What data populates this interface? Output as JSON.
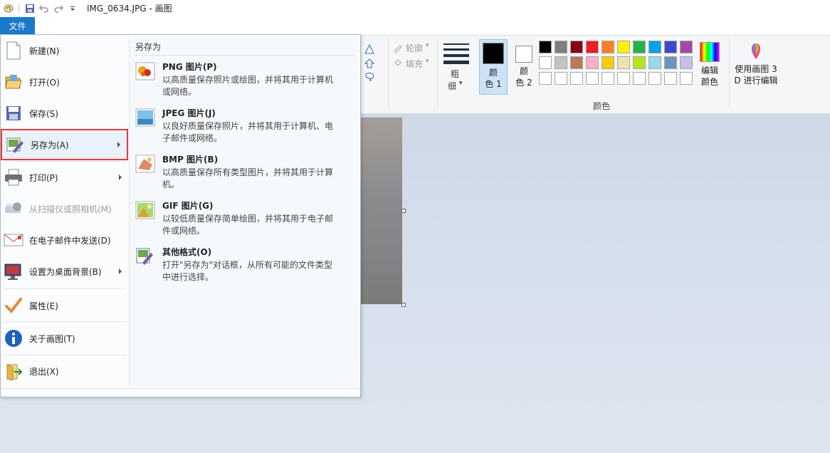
{
  "window": {
    "title": "IMG_0634.JPG - 画图"
  },
  "ribbon": {
    "outline_label": "轮廓",
    "fill_label": "填充",
    "size_label_1": "粗",
    "size_label_2": "细",
    "color1_label_1": "颜",
    "color1_label_2": "色 1",
    "color2_label_1": "颜",
    "color2_label_2": "色 2",
    "edit_colors_1": "编辑",
    "edit_colors_2": "颜色",
    "paint3d_1": "使用画图 3",
    "paint3d_2": "D 进行编辑",
    "colors_group": "颜色",
    "color1": "#000000",
    "color2": "#ffffff",
    "palette": [
      "#000000",
      "#7f7f7f",
      "#880015",
      "#ed1c24",
      "#ff7f27",
      "#fff200",
      "#22b14c",
      "#00a2e8",
      "#3f48cc",
      "#a349a4",
      "#ffffff",
      "#c3c3c3",
      "#b97a57",
      "#ffaec9",
      "#ffc90e",
      "#efe4b0",
      "#b5e61d",
      "#99d9ea",
      "#7092be",
      "#c8bfe7",
      "#ffffff",
      "#ffffff",
      "#ffffff",
      "#ffffff",
      "#ffffff",
      "#ffffff",
      "#ffffff",
      "#ffffff",
      "#ffffff",
      "#ffffff"
    ]
  },
  "file_tab": "文件",
  "menu": {
    "items": [
      {
        "label": "新建(N)",
        "icon": "new-file-icon"
      },
      {
        "label": "打开(O)",
        "icon": "open-folder-icon"
      },
      {
        "label": "保存(S)",
        "icon": "save-icon"
      },
      {
        "label": "另存为(A)",
        "icon": "save-as-icon"
      },
      {
        "label": "打印(P)",
        "icon": "printer-icon"
      },
      {
        "label": "从扫描仪或照相机(M)",
        "icon": "scanner-icon"
      },
      {
        "label": "在电子邮件中发送(D)",
        "icon": "email-icon"
      },
      {
        "label": "设置为桌面背景(B)",
        "icon": "desktop-icon"
      },
      {
        "label": "属性(E)",
        "icon": "checkmark-icon"
      },
      {
        "label": "关于画图(T)",
        "icon": "info-icon"
      },
      {
        "label": "退出(X)",
        "icon": "exit-icon"
      }
    ],
    "submenu": {
      "title": "另存为",
      "items": [
        {
          "name": "PNG 图片(P)",
          "desc": "以高质量保存照片或绘图，并将其用于计算机或网络。"
        },
        {
          "name": "JPEG 图片(J)",
          "desc": "以良好质量保存照片，并将其用于计算机、电子邮件或网络。"
        },
        {
          "name": "BMP 图片(B)",
          "desc": "以高质量保存所有类型图片，并将其用于计算机。"
        },
        {
          "name": "GIF 图片(G)",
          "desc": "以较低质量保存简单绘图，并将其用于电子邮件或网络。"
        },
        {
          "name": "其他格式(O)",
          "desc": "打开\"另存为\"对话框，从所有可能的文件类型中进行选择。"
        }
      ]
    }
  }
}
